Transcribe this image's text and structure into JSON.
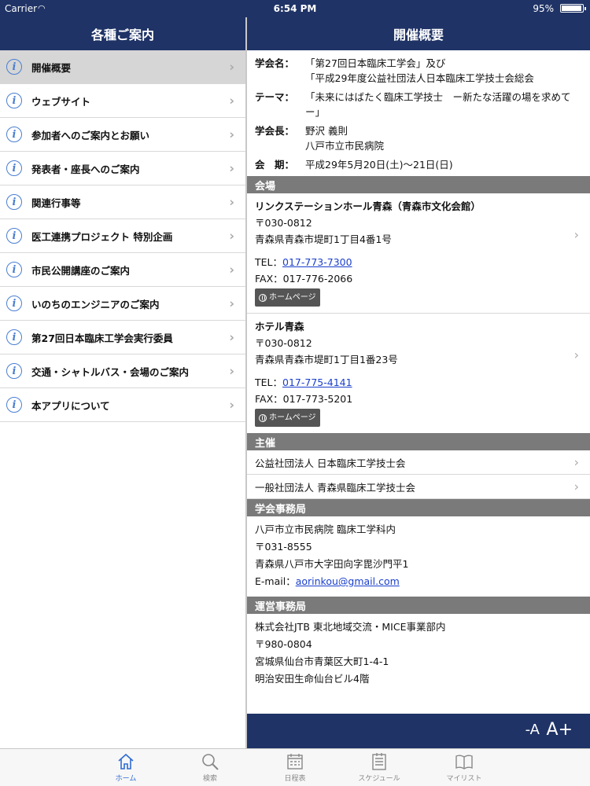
{
  "status_bar": {
    "carrier": "Carrier",
    "time": "6:54 PM",
    "battery": "95%"
  },
  "left": {
    "title": "各種ご案内",
    "items": [
      {
        "label": "開催概要",
        "selected": true
      },
      {
        "label": "ウェブサイト"
      },
      {
        "label": "参加者へのご案内とお願い"
      },
      {
        "label": "発表者・座長へのご案内"
      },
      {
        "label": "関連行事等"
      },
      {
        "label": "医工連携プロジェクト 特別企画"
      },
      {
        "label": "市民公開講座のご案内"
      },
      {
        "label": "いのちのエンジニアのご案内"
      },
      {
        "label": "第27回日本臨床工学会実行委員"
      },
      {
        "label": "交通・シャトルバス・会場のご案内"
      },
      {
        "label": "本アプリについて"
      }
    ]
  },
  "right": {
    "title": "開催概要",
    "overview": {
      "society_label": "学会名：",
      "society_line1": "「第27回日本臨床工学会」及び",
      "society_line2": "「平成29年度公益社団法人日本臨床工学技士会総会",
      "theme_label": "テーマ：",
      "theme_value": "「未来にはばたく臨床工学技士　ー新たな活躍の場を求めてー」",
      "president_label": "学会長：",
      "president_name": "野沢 義則",
      "president_org": "八戸市立市民病院",
      "period_label": "会　期：",
      "period_value": "平成29年5月20日(土)〜21日(日)"
    },
    "venue_header": "会場",
    "venues": [
      {
        "name": "リンクステーションホール青森（青森市文化会館）",
        "zip": "〒030-0812",
        "address": "青森県青森市堤町1丁目4番1号",
        "tel_label": "TEL：",
        "tel": "017-773-7300",
        "fax": "FAX：017-776-2066",
        "hp": "ホームページ"
      },
      {
        "name": "ホテル青森",
        "zip": "〒030-0812",
        "address": "青森県青森市堤町1丁目1番23号",
        "tel_label": "TEL：",
        "tel": "017-775-4141",
        "fax": "FAX：017-773-5201",
        "hp": "ホームページ"
      }
    ],
    "host_header": "主催",
    "hosts": [
      "公益社団法人 日本臨床工学技士会",
      "一般社団法人 青森県臨床工学技士会"
    ],
    "office_header": "学会事務局",
    "office": {
      "line1": "八戸市立市民病院 臨床工学科内",
      "line2": "〒031-8555",
      "line3": "青森県八戸市大字田向字毘沙門平1",
      "email_label": "E-mail：",
      "email": "aorinkou@gmail.com"
    },
    "ops_header": "運営事務局",
    "ops": {
      "line1": "株式会社JTB 東北地域交流・MICE事業部内",
      "line2": "〒980-0804",
      "line3": "宮城県仙台市青葉区大町1-4-1",
      "line4": "明治安田生命仙台ビル4階"
    },
    "font_minus": "-A",
    "font_plus": "A+"
  },
  "tabs": [
    {
      "label": "ホーム",
      "icon": "home-icon",
      "active": true
    },
    {
      "label": "検索",
      "icon": "search-icon"
    },
    {
      "label": "日程表",
      "icon": "calendar-icon"
    },
    {
      "label": "スケジュール",
      "icon": "schedule-icon"
    },
    {
      "label": "マイリスト",
      "icon": "book-icon"
    }
  ]
}
